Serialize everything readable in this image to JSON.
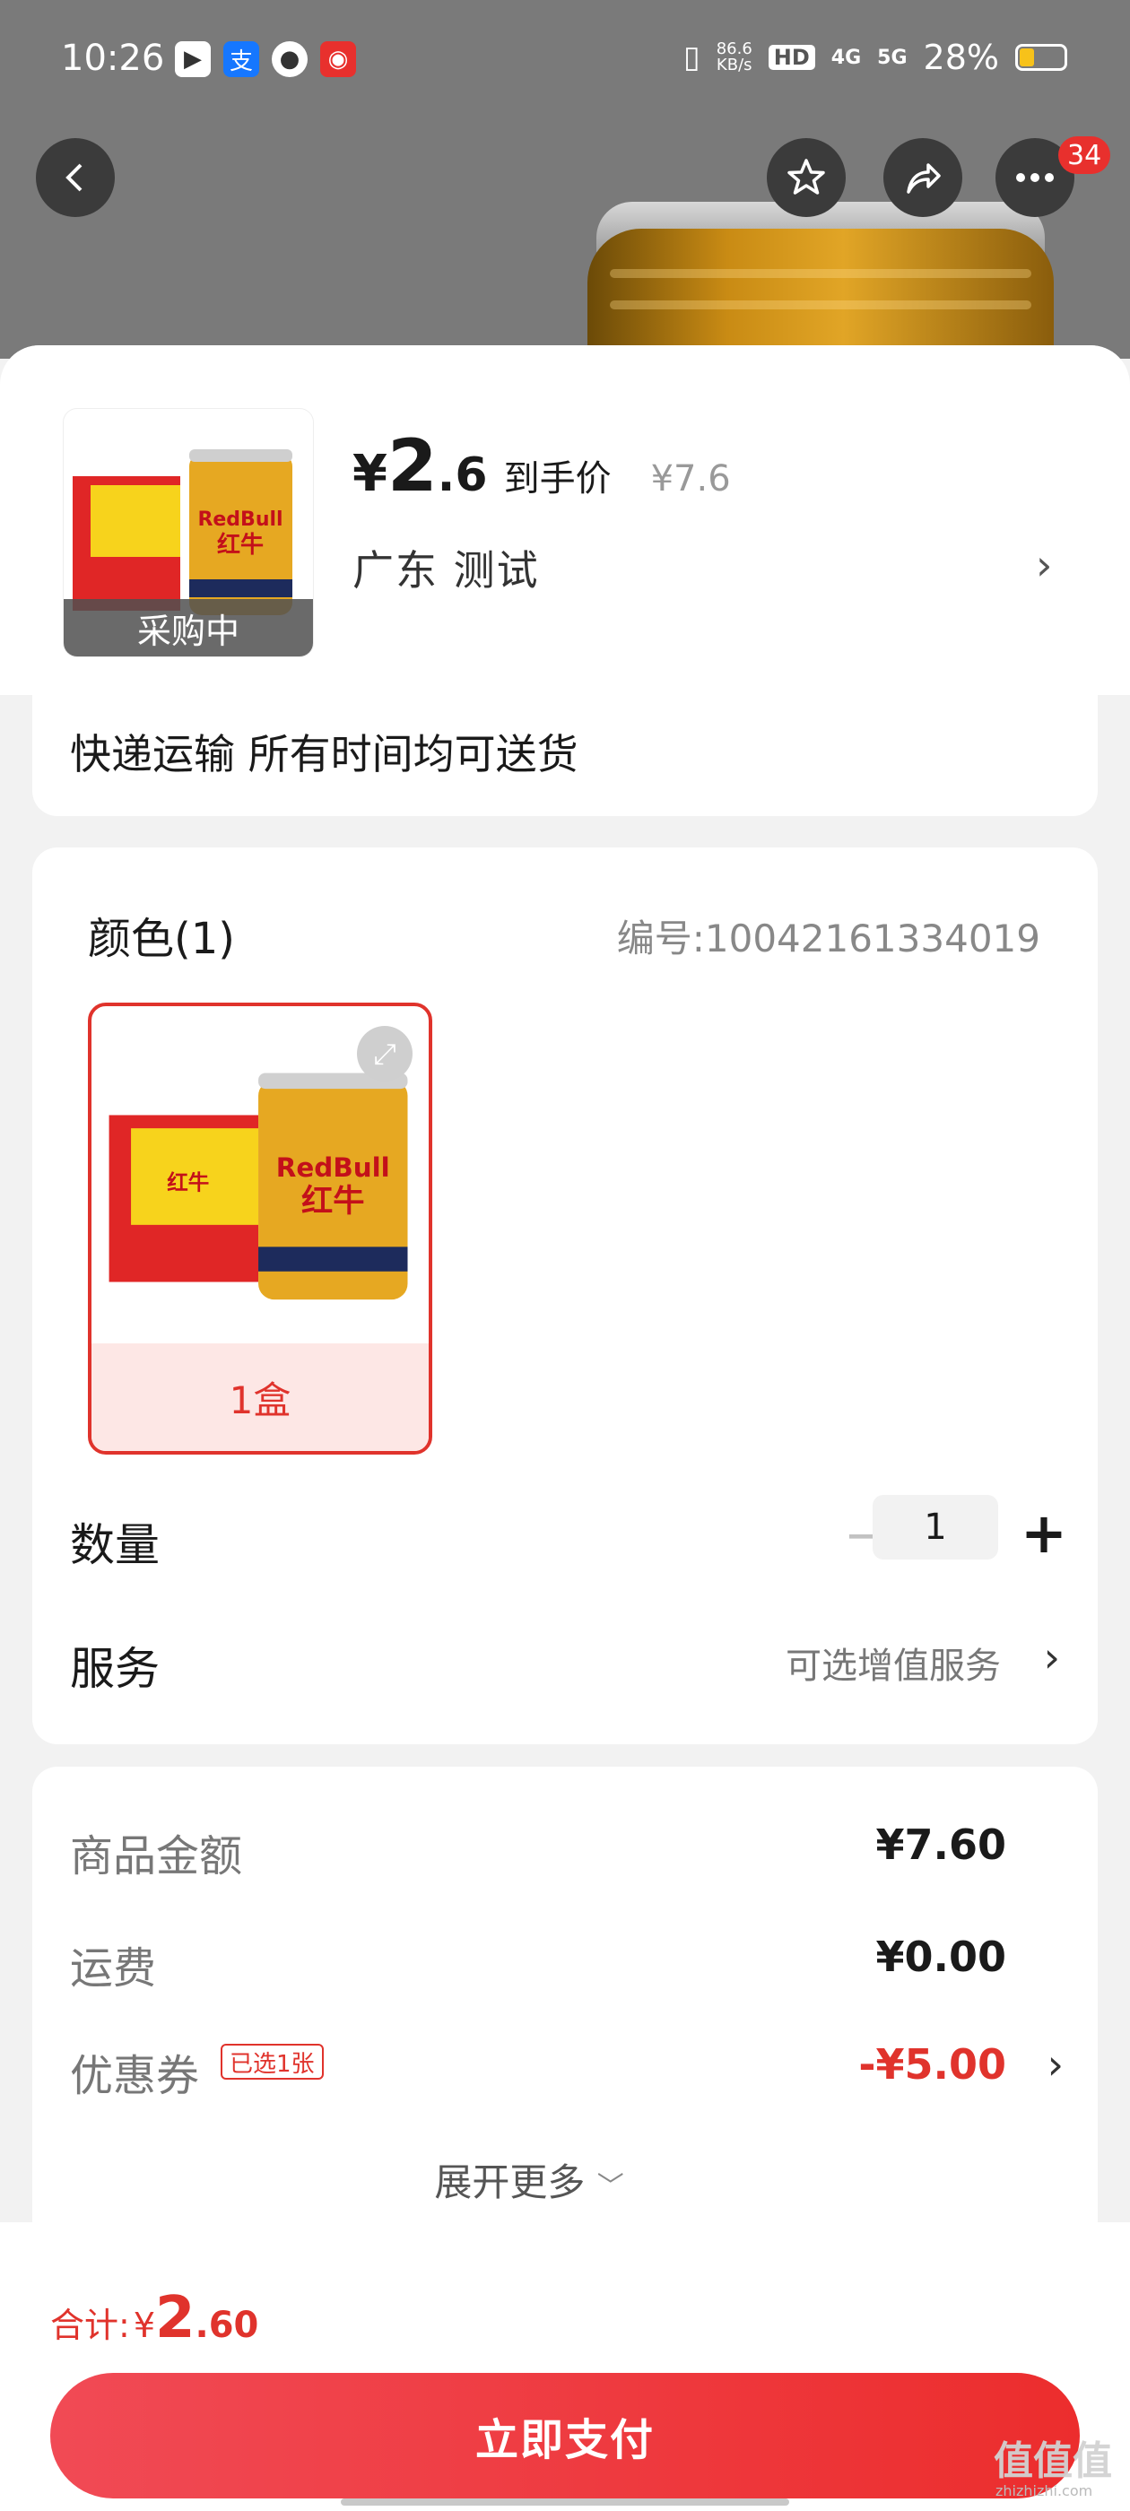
{
  "status_bar": {
    "time": "10:26",
    "net_speed": "86.6\nKB/s",
    "net_speed_top": "86.6",
    "net_speed_bottom": "KB/s",
    "hd": "HD",
    "sig1": "4G",
    "sig2": "5G",
    "battery": "28%"
  },
  "nav": {
    "badge": "34"
  },
  "product": {
    "price_currency": "¥",
    "price_int": "2",
    "price_dec": ".6",
    "price_tag": "到手价",
    "price_original": "¥7.6",
    "thumb_label": "采购中",
    "address": "广东  测试",
    "delivery": "快递运输 所有时间均可送货"
  },
  "spec": {
    "title": "颜色(1)",
    "code": "编号:10042161334019",
    "option_label": "1盒",
    "quantity_label": "数量",
    "quantity": "1",
    "service_label": "服务",
    "service_value": "可选增值服务"
  },
  "summary": {
    "goods_label": "商品金额",
    "goods_value": "¥7.60",
    "shipping_label": "运费",
    "shipping_value": "¥0.00",
    "coupon_label": "优惠券",
    "coupon_tag": "已选1张",
    "coupon_value": "-¥5.00",
    "expand_label": "展开更多"
  },
  "footer": {
    "total_label": "合计:",
    "total_currency": "¥",
    "total_int": "2",
    "total_dec": ".60",
    "pay_label": "立即支付",
    "watermark": "值值值",
    "watermark_sub": "zhizhizhi.com"
  },
  "colors": {
    "accent": "#e0332c",
    "pay_button": "#ee3a3f"
  }
}
